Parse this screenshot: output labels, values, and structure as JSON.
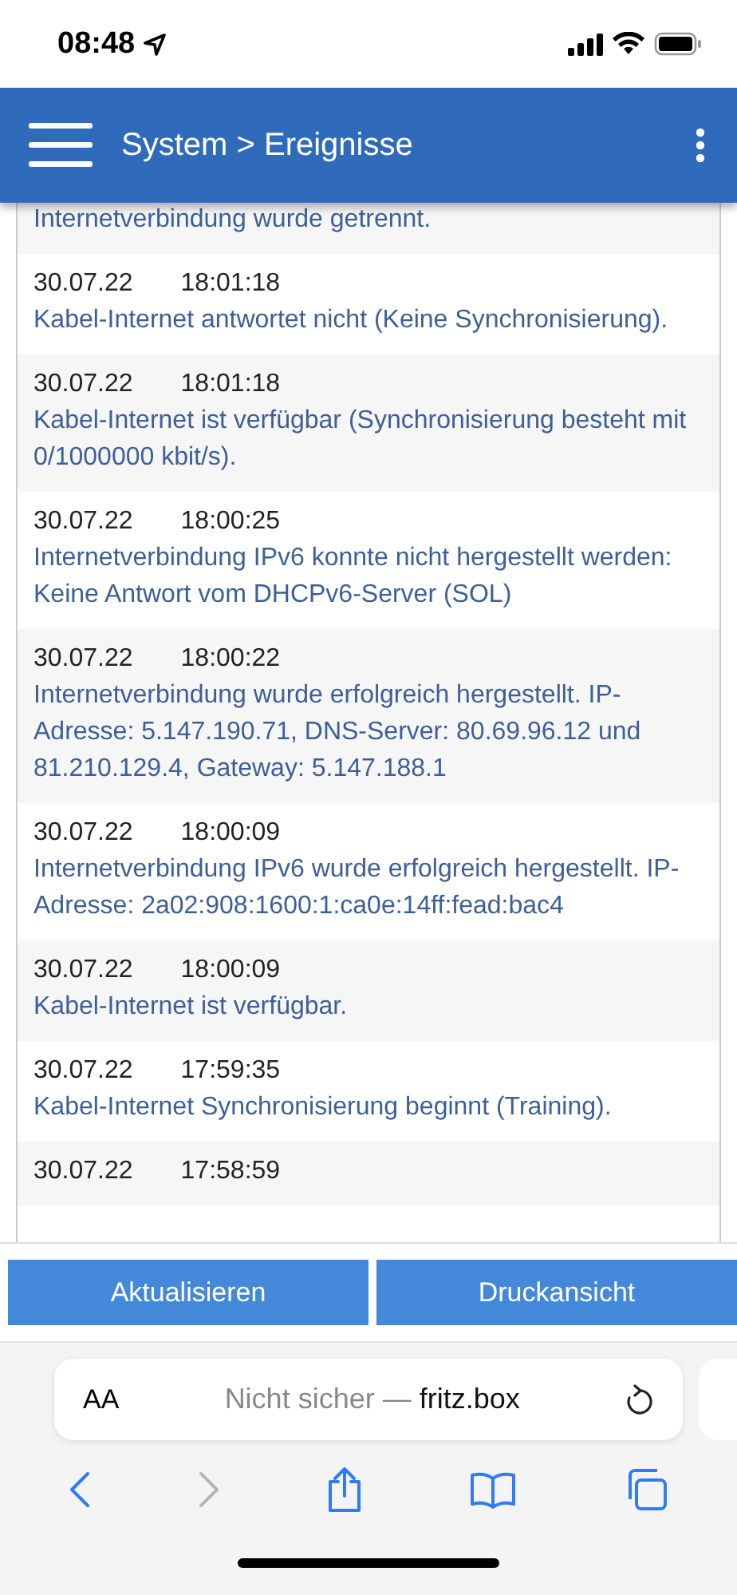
{
  "status_bar": {
    "time": "08:48"
  },
  "header": {
    "title": "System > Ereignisse"
  },
  "events": [
    {
      "message": "Internetverbindung wurde getrennt."
    },
    {
      "date": "30.07.22",
      "time": "18:01:18",
      "message": "Kabel-Internet antwortet nicht (Keine Synchronisierung)."
    },
    {
      "date": "30.07.22",
      "time": "18:01:18",
      "message": "Kabel-Internet ist verfügbar (Synchronisierung besteht mit 0/1000000 kbit/s)."
    },
    {
      "date": "30.07.22",
      "time": "18:00:25",
      "message": "Internetverbindung IPv6 konnte nicht hergestellt werden: Keine Antwort vom DHCPv6-Server (SOL)"
    },
    {
      "date": "30.07.22",
      "time": "18:00:22",
      "message": "Internetverbindung wurde erfolgreich hergestellt. IP-Adresse: 5.147.190.71, DNS-Server: 80.69.96.12 und 81.210.129.4, Gateway: 5.147.188.1"
    },
    {
      "date": "30.07.22",
      "time": "18:00:09",
      "message": "Internetverbindung IPv6 wurde erfolgreich hergestellt. IP-Adresse: 2a02:908:1600:1:ca0e:14ff:fead:bac4"
    },
    {
      "date": "30.07.22",
      "time": "18:00:09",
      "message": "Kabel-Internet ist verfügbar."
    },
    {
      "date": "30.07.22",
      "time": "17:59:35",
      "message": "Kabel-Internet Synchronisierung beginnt (Training)."
    },
    {
      "date": "30.07.22",
      "time": "17:58:59"
    }
  ],
  "buttons": [
    "Aktualisieren",
    "Druckansicht"
  ],
  "browser": {
    "text_size": "AA",
    "security": "Nicht sicher —",
    "domain": "fritz.box"
  }
}
